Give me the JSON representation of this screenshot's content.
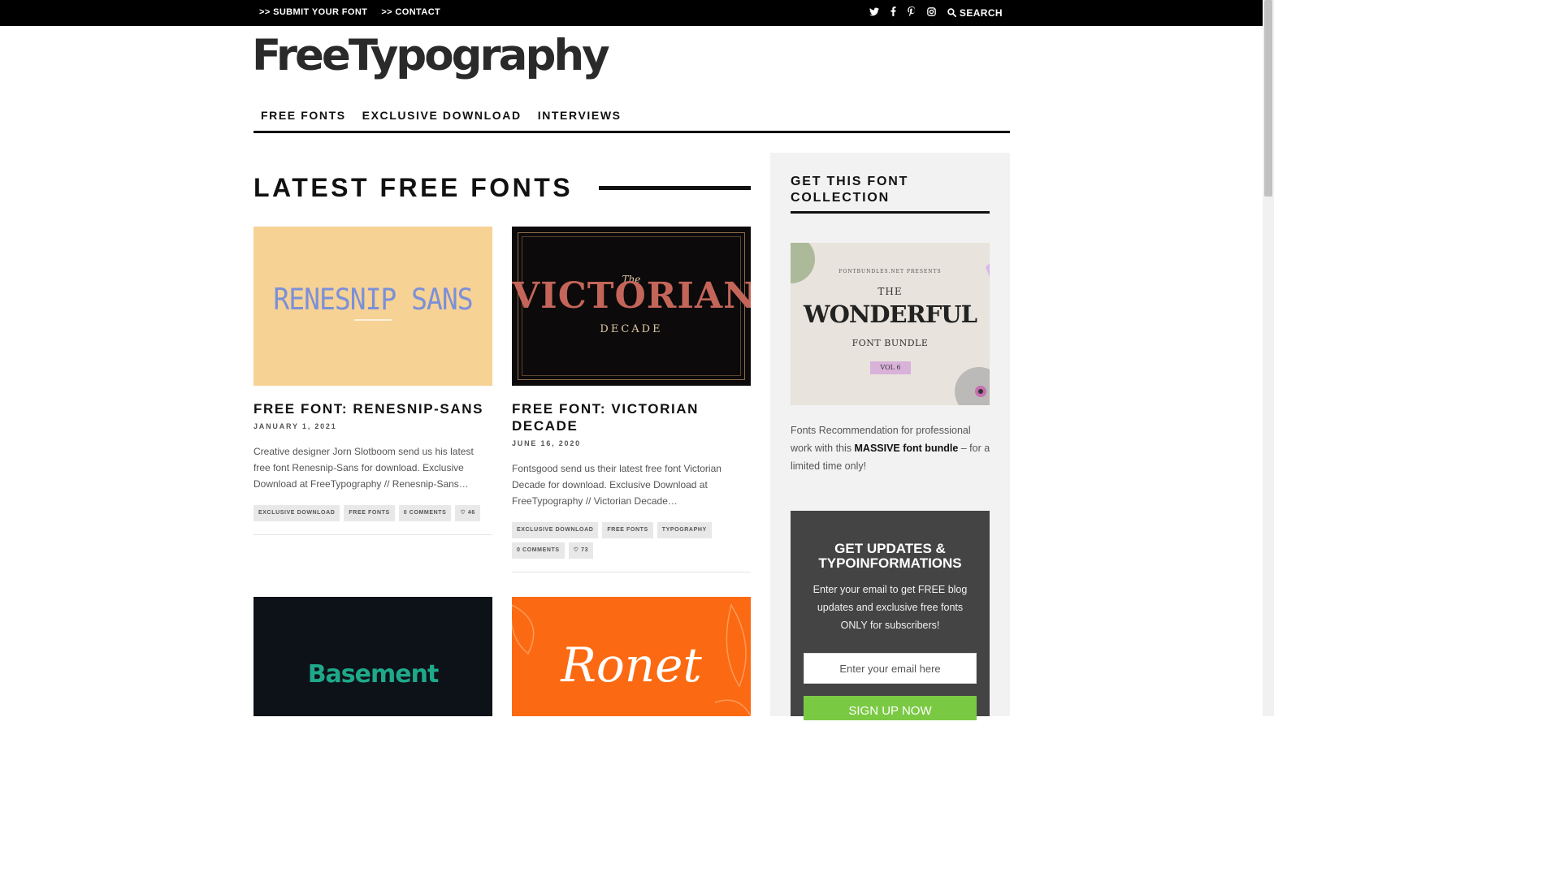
{
  "topbar": {
    "submit_link": ">> SUBMIT YOUR FONT",
    "contact_link": ">> CONTACT",
    "search_label": "SEARCH",
    "social_icons": [
      "twitter-icon",
      "facebook-icon",
      "pinterest-icon",
      "instagram-icon"
    ]
  },
  "logo": "FreeTypography",
  "nav": [
    "FREE FONTS",
    "EXCLUSIVE DOWNLOAD",
    "INTERVIEWS"
  ],
  "main": {
    "section_title": "LATEST FREE FONTS",
    "posts": [
      {
        "thumb_text": "RENESNIP SANS",
        "title": "FREE FONT: RENESNIP-SANS",
        "date": "JANUARY 1, 2021",
        "excerpt": "Creative designer Jorn Slotboom send us his latest free font Renesnip-Sans for download. Exclusive Download at FreeTypography // Renesnip-Sans…",
        "tags": [
          "EXCLUSIVE DOWNLOAD",
          "FREE FONTS",
          "0 COMMENTS",
          "♡ 46"
        ]
      },
      {
        "thumb_text": "VICTORIAN",
        "thumb_sub": "DECADE",
        "thumb_the": "The",
        "title": "FREE FONT: VICTORIAN DECADE",
        "date": "JUNE 16, 2020",
        "excerpt": "Fontsgood send us their latest free font Victorian Decade for download. Exclusive Download at FreeTypography // Victorian Decade…",
        "tags": [
          "EXCLUSIVE DOWNLOAD",
          "FREE FONTS",
          "TYPOGRAPHY",
          "0 COMMENTS",
          "♡ 73"
        ]
      },
      {
        "thumb_text": "Basement"
      },
      {
        "thumb_text": "Ronet"
      }
    ]
  },
  "sidebar": {
    "heading": "GET THIS FONT COLLECTION",
    "promo_image": {
      "presents": "FONTBUNDLES.NET PRESENTS",
      "the": "THE",
      "title": "WONDERFUL",
      "subtitle": "FONT BUNDLE",
      "vol": "VOL 6"
    },
    "promo_text_before": "Fonts Recommendation for professional work with this ",
    "promo_text_bold": "MASSIVE font bundle",
    "promo_text_after": " – for a limited time only!",
    "newsletter": {
      "title": "GET UPDATES & TYPOINFORMATIONS",
      "text": "Enter your email to get FREE blog updates and exclusive free fonts ONLY for subscribers!",
      "email_placeholder": "Enter your email here",
      "button": "SIGN UP NOW"
    }
  },
  "colors": {
    "topbar": "#000000",
    "signup_button": "#7ac943",
    "newsletter_bg": "#444444",
    "sidebar_bg": "#f2f2f2"
  }
}
